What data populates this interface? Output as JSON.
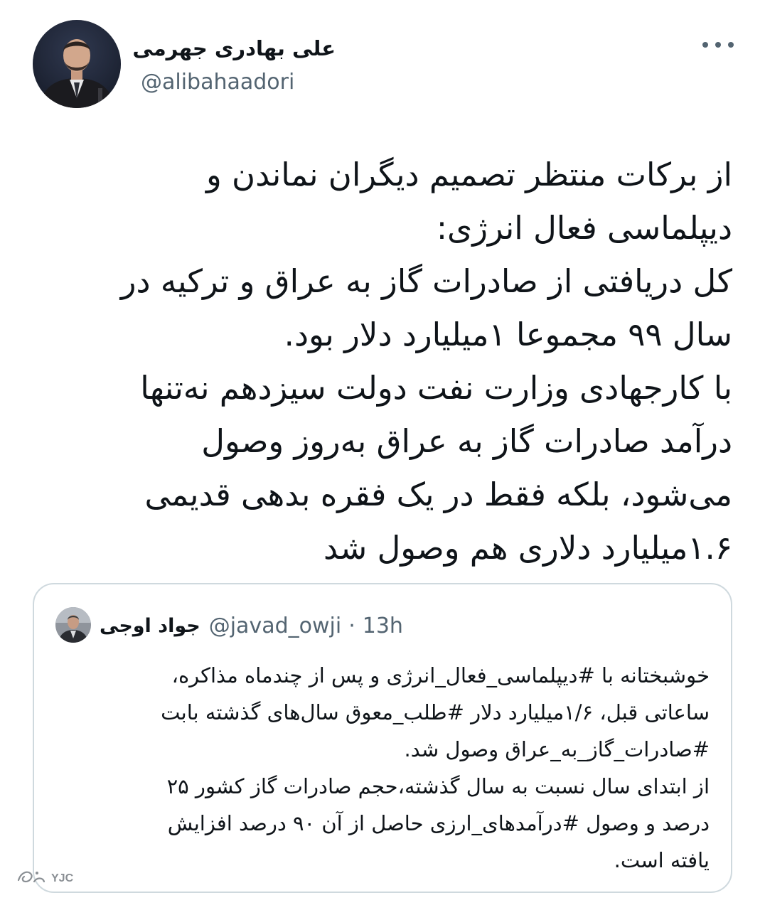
{
  "author": {
    "name": "علی بهادری جهرمی",
    "handle": "@alibahaadori"
  },
  "tweet": {
    "lines": [
      "از برکات منتظر تصمیم دیگران نماندن و",
      "دیپلماسی فعال انرژی:",
      "کل دریافتی از صادرات گاز به عراق و ترکیه در",
      "سال ۹۹ مجموعا ۱میلیارد دلار بود.",
      "با کارجهادی وزارت نفت دولت سیزدهم نه‌تنها",
      "درآمد صادرات گاز به عراق به‌روز وصول",
      "می‌شود، بلکه فقط در یک فقره بدهی قدیمی",
      "۱.۶میلیارد دلاری هم وصول شد"
    ]
  },
  "quoted": {
    "name": "جواد اوجی",
    "handle": "@javad_owji",
    "separator": "·",
    "time": "13h",
    "lines": [
      "خوشبختانه با #دیپلماسی_فعال_انرژی و پس از چندماه مذاکره،",
      "ساعاتی قبل، ۱/۶میلیارد دلار #طلب_معوق سال‌های گذشته بابت",
      "#صادرات_گاز_به_عراق وصول شد.",
      "از ابتدای سال نسبت به سال گذشته،حجم صادرات گاز کشور ۲۵",
      "درصد و وصول #درآمدهای_ارزی حاصل از آن ۹۰ درصد افزایش",
      "یافته است."
    ]
  },
  "watermark": {
    "text": "YJC",
    "icon": "yjc-logo-icon"
  },
  "icons": {
    "more": "more-options-icon"
  }
}
